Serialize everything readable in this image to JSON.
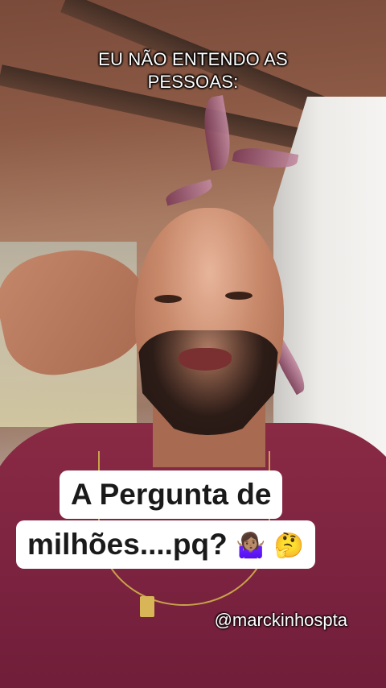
{
  "caption": {
    "line1": "EU NÃO ENTENDO AS",
    "line2": "PESSOAS:"
  },
  "sticker": {
    "line1": "A Pergunta de",
    "line2_text": "milhões....pq?",
    "emoji1": "🤷🏽‍♀️",
    "emoji2": "🤔"
  },
  "watermark": {
    "handle": "@marckinhospta"
  }
}
